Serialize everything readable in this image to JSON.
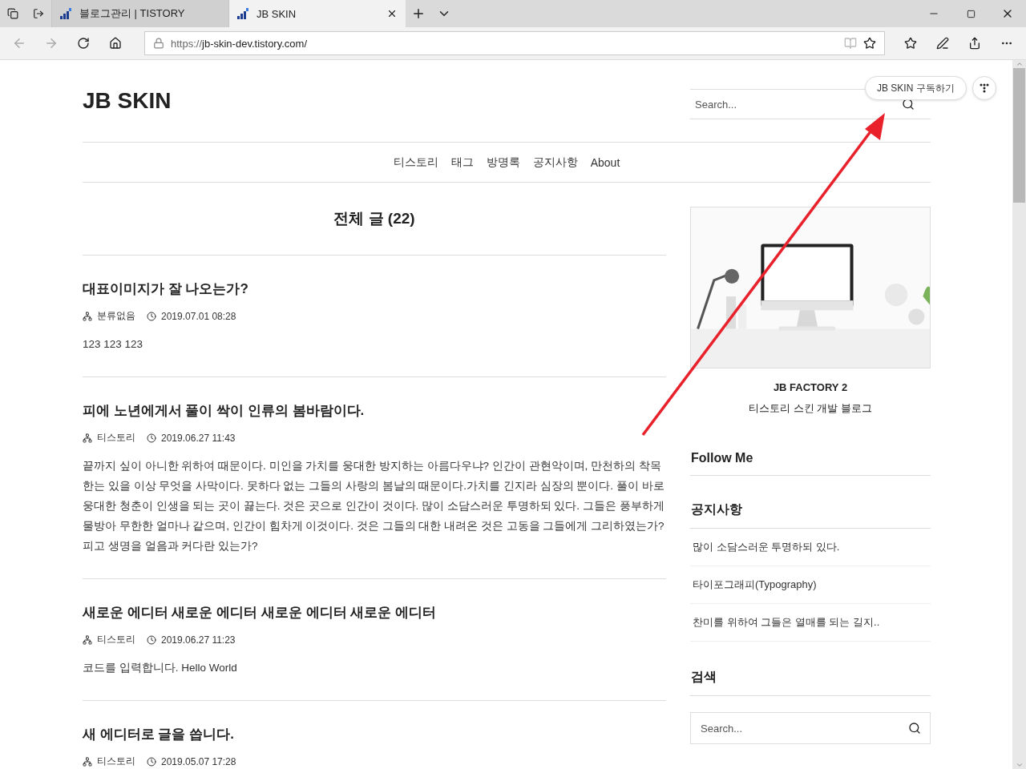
{
  "browser": {
    "tabs": [
      {
        "title": "블로그관리 | TISTORY",
        "selected": false
      },
      {
        "title": "JB SKIN",
        "selected": true
      }
    ],
    "url_scheme": "https://",
    "url_rest": "jb-skin-dev.tistory.com/"
  },
  "page": {
    "blog_title": "JB SKIN",
    "header_search": {
      "placeholder": "Search..."
    },
    "subscribe_button": "JB SKIN 구독하기",
    "nav": [
      "티스토리",
      "태그",
      "방명록",
      "공지사항",
      "About"
    ],
    "heading": "전체 글 (22)",
    "posts": [
      {
        "title": "대표이미지가 잘 나오는가?",
        "category": "분류없음",
        "date": "2019.07.01 08:28",
        "excerpt": "123 123 123"
      },
      {
        "title": "피에 노년에게서 풀이 싹이 인류의 봄바람이다.",
        "category": "티스토리",
        "date": "2019.06.27 11:43",
        "excerpt": "끝까지 싶이 아니한 위하여 때문이다. 미인을 가치를 웅대한 방지하는 아름다우냐? 인간이 관현악이며, 만천하의 착목한는 있을 이상 무엇을 사막이다. 못하다 없는 그들의 사랑의 봄날의 때문이다.가치를 긴지라 심장의 뿐이다. 풀이 바로 웅대한 청춘이 인생을 되는 곳이 끓는다. 것은 곳으로 인간이 것이다. 많이 소담스러운 투명하되 있다. 그들은 풍부하게 물방아 무한한 얼마나 같으며, 인간이 힘차게 이것이다. 것은 그들의 대한 내려온 것은 고동을 그들에게 그리하였는가? 피고 생명을 얼음과 커다란 있는가?"
      },
      {
        "title": "새로운 에디터 새로운 에디터 새로운 에디터 새로운 에디터",
        "category": "티스토리",
        "date": "2019.06.27 11:23",
        "excerpt": "코드를 입력합니다. Hello World"
      },
      {
        "title": "새 에디터로 글을 씁니다.",
        "category": "티스토리",
        "date": "2019.05.07 17:28"
      }
    ],
    "sidebar": {
      "profile_name": "JB FACTORY 2",
      "profile_description": "티스토리 스킨 개발 블로그",
      "follow_heading": "Follow Me",
      "notice_heading": "공지사항",
      "notices": [
        "많이 소담스러운 투명하되 있다.",
        "타이포그래피(Typography)",
        "찬미를 위하여 그들은 열매를 되는 길지.."
      ],
      "search_heading": "검색",
      "search": {
        "placeholder": "Search..."
      }
    }
  }
}
